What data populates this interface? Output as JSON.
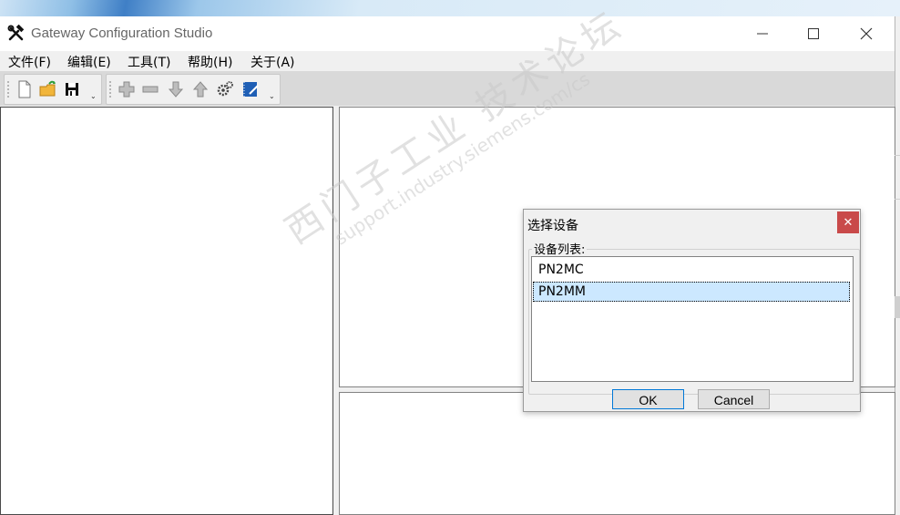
{
  "window": {
    "title": "Gateway Configuration Studio"
  },
  "menu": [
    "文件(F)",
    "编辑(E)",
    "工具(T)",
    "帮助(H)",
    "关于(A)"
  ],
  "toolbar1": {
    "icons": [
      "new-file-icon",
      "open-folder-icon",
      "save-icon"
    ]
  },
  "toolbar2": {
    "icons": [
      "add-icon",
      "remove-icon",
      "move-down-icon",
      "move-up-icon",
      "settings-icon",
      "edit-notebook-icon"
    ]
  },
  "watermark": {
    "cn": "西门子工业 技术论坛",
    "url": "support.industry.siemens.com/cs"
  },
  "dialog": {
    "title": "选择设备",
    "group_label": "设备列表:",
    "items": [
      "PN2MC",
      "PN2MM"
    ],
    "selected_index": 1,
    "ok_label": "OK",
    "cancel_label": "Cancel"
  },
  "colors": {
    "selection": "#cce8ff",
    "close_button": "#c94a4a",
    "default_button_border": "#0078d7"
  }
}
